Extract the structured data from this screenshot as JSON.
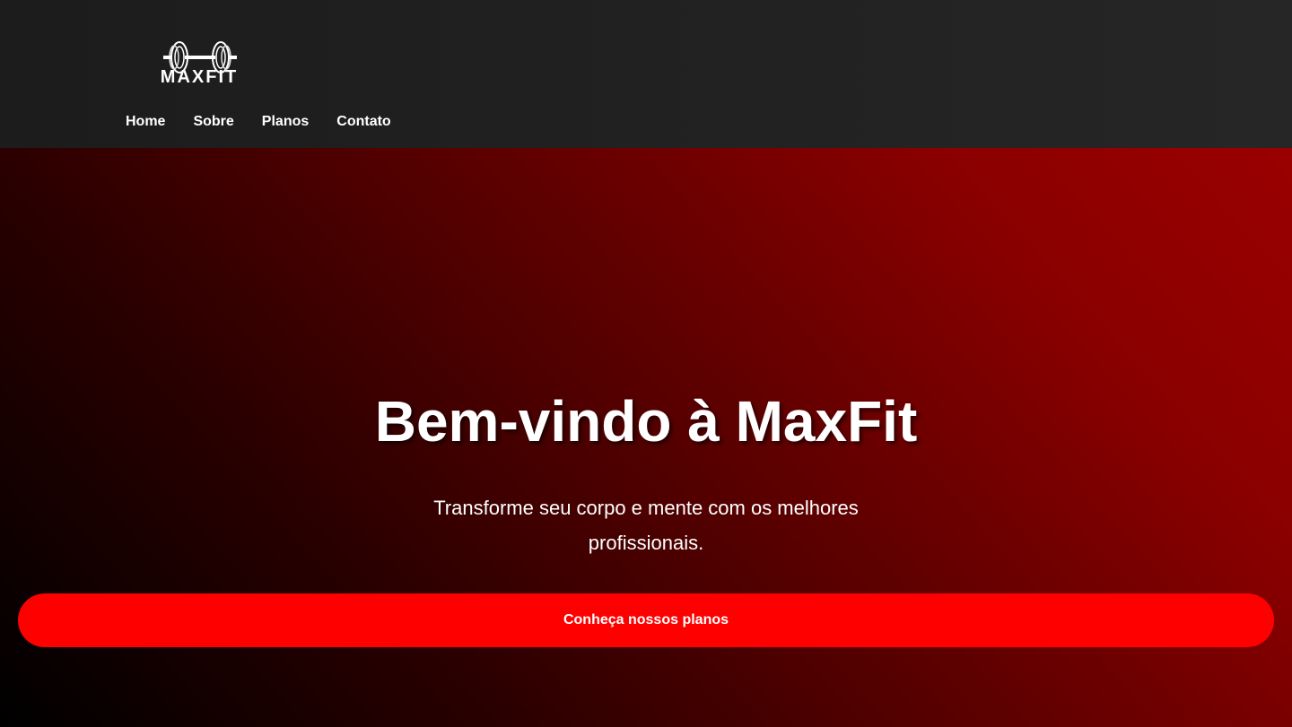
{
  "header": {
    "logo": {
      "text": "MAXFIT",
      "icon": "dumbbell-icon"
    },
    "nav": [
      {
        "label": "Home"
      },
      {
        "label": "Sobre"
      },
      {
        "label": "Planos"
      },
      {
        "label": "Contato"
      }
    ]
  },
  "hero": {
    "title": "Bem-vindo à MaxFit",
    "subtitle": "Transforme seu corpo e mente com os melhores profissionais.",
    "cta_label": "Conheça nossos planos"
  },
  "colors": {
    "header_bg": "#222222",
    "accent": "#ff0000",
    "hero_dark": "#000000",
    "hero_red": "#9a0000"
  }
}
